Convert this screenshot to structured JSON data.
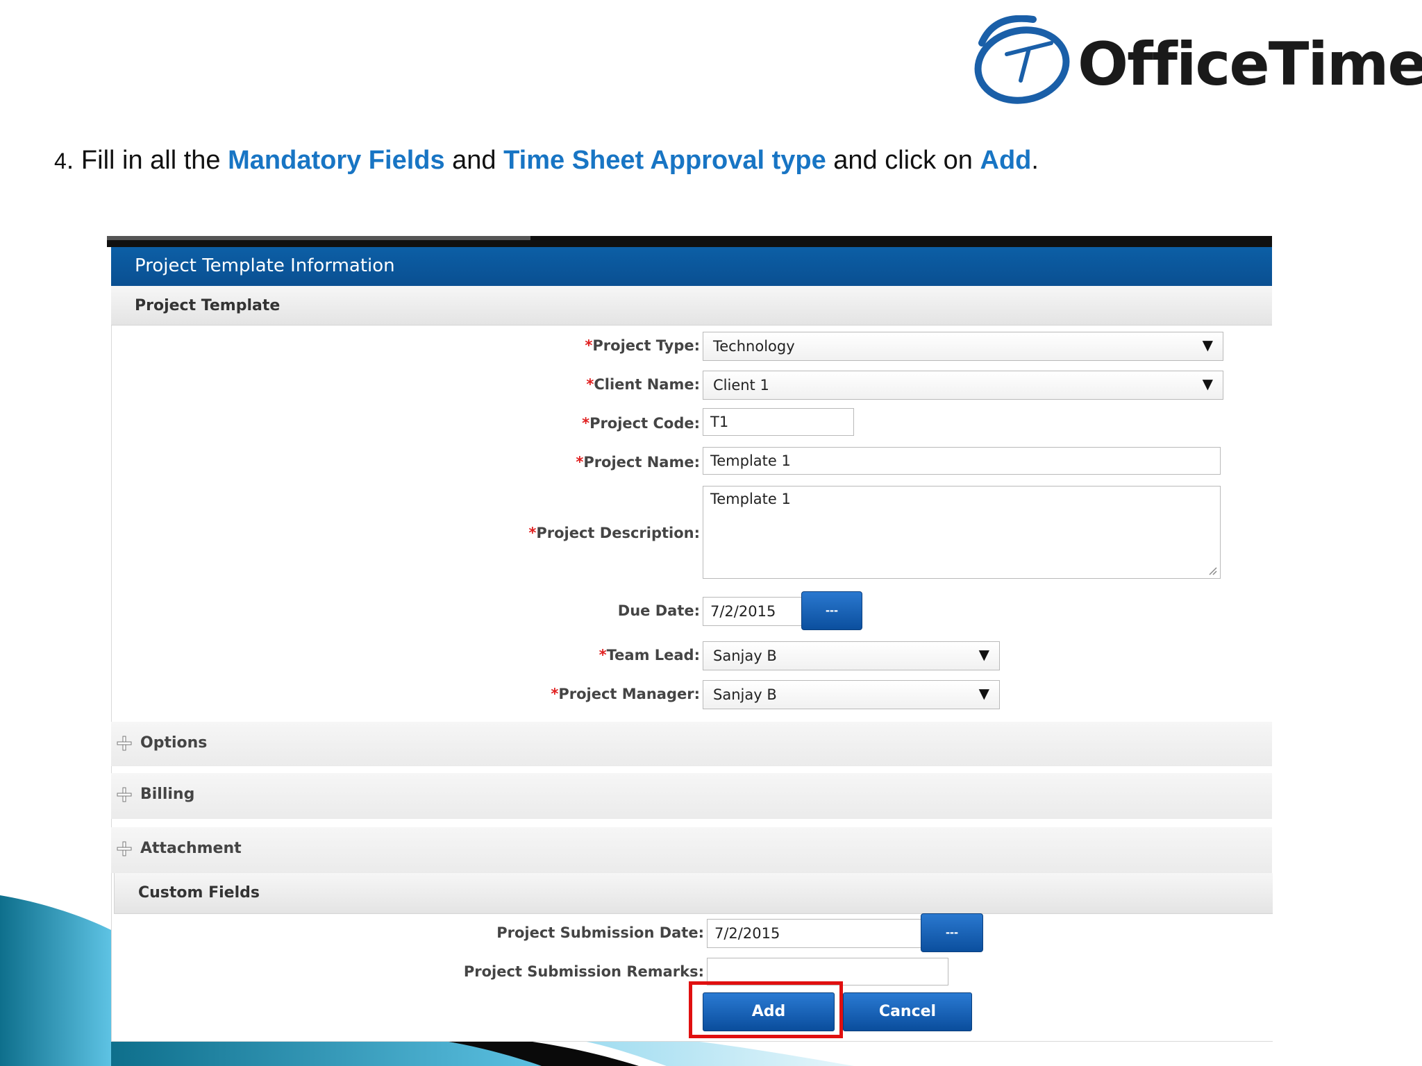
{
  "brand": {
    "name": "OfficeTimer",
    "accent": "#1875c4"
  },
  "instruction": {
    "step": "4",
    "p1": ". Fill in all the ",
    "h1": "Mandatory Fields",
    "p2": " and ",
    "h2": "Time Sheet Approval type",
    "p3": " and click on ",
    "h3": "Add",
    "p4": "."
  },
  "panel": {
    "title": "Project Template Information",
    "section_title": "Project Template"
  },
  "form": {
    "required_marker": "*",
    "project_type": {
      "label": "Project Type:",
      "value": "Technology"
    },
    "client_name": {
      "label": "Client Name:",
      "value": "Client 1"
    },
    "project_code": {
      "label": "Project Code:",
      "value": "T1"
    },
    "project_name": {
      "label": "Project Name:",
      "value": "Template 1"
    },
    "project_description": {
      "label": "Project Description:",
      "value": "Template 1"
    },
    "due_date": {
      "label": "Due Date:",
      "value": "7/2/2015",
      "picker": "---"
    },
    "team_lead": {
      "label": "Team Lead:",
      "value": "Sanjay B"
    },
    "project_manager": {
      "label": "Project Manager:",
      "value": "Sanjay B"
    }
  },
  "sections": {
    "options": "Options",
    "billing": "Billing",
    "attachment": "Attachment",
    "custom_fields": "Custom Fields"
  },
  "custom": {
    "submission_date": {
      "label": "Project Submission Date:",
      "value": "7/2/2015",
      "picker": "---"
    },
    "submission_remarks": {
      "label": "Project Submission Remarks:",
      "value": ""
    }
  },
  "actions": {
    "add": "Add",
    "cancel": "Cancel"
  }
}
